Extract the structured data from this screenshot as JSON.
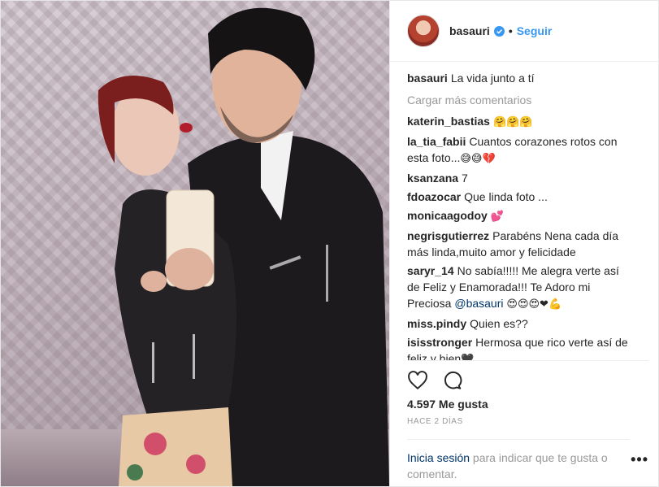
{
  "post": {
    "username": "basauri",
    "follow_label": "Seguir",
    "separator": "•",
    "caption": "La vida junto a tí",
    "load_more": "Cargar más comentarios",
    "comments": [
      {
        "user": "katerin_bastias",
        "text": "",
        "emoji": "🤗🤗🤗"
      },
      {
        "user": "la_tia_fabii",
        "text": "Cuantos corazones rotos con esta foto...",
        "emoji": "😅😅💔"
      },
      {
        "user": "ksanzana",
        "text": "7",
        "emoji": ""
      },
      {
        "user": "fdoazocar",
        "text": "Que linda foto ...",
        "emoji": ""
      },
      {
        "user": "monicaagodoy",
        "text": "",
        "emoji": "💕"
      },
      {
        "user": "negrisgutierrez",
        "text": "Parabéns Nena cada día más linda,muito amor y felicidade",
        "emoji": ""
      },
      {
        "user": "saryr_14",
        "text": "No sabía!!!!! Me alegra verte así de Feliz y Enamorada!!! Te Adoro mi Preciosa",
        "mention": "@basauri",
        "emoji": "😍😍😍❤💪"
      },
      {
        "user": "miss.pindy",
        "text": "Quien es??",
        "emoji": ""
      },
      {
        "user": "isisstronger",
        "text": "Hermosa que rico verte así de feliz y bien",
        "emoji": "🖤"
      }
    ],
    "likes": "4.597 Me gusta",
    "date": "HACE 2 DÍAS",
    "login_link": "Inicia sesión",
    "login_text": " para indicar que te gusta o comentar.",
    "more_options": "•••",
    "icons": {
      "like": "heart-icon",
      "comment": "comment-icon",
      "verified": "verified-badge-icon",
      "options": "more-options-icon"
    }
  }
}
